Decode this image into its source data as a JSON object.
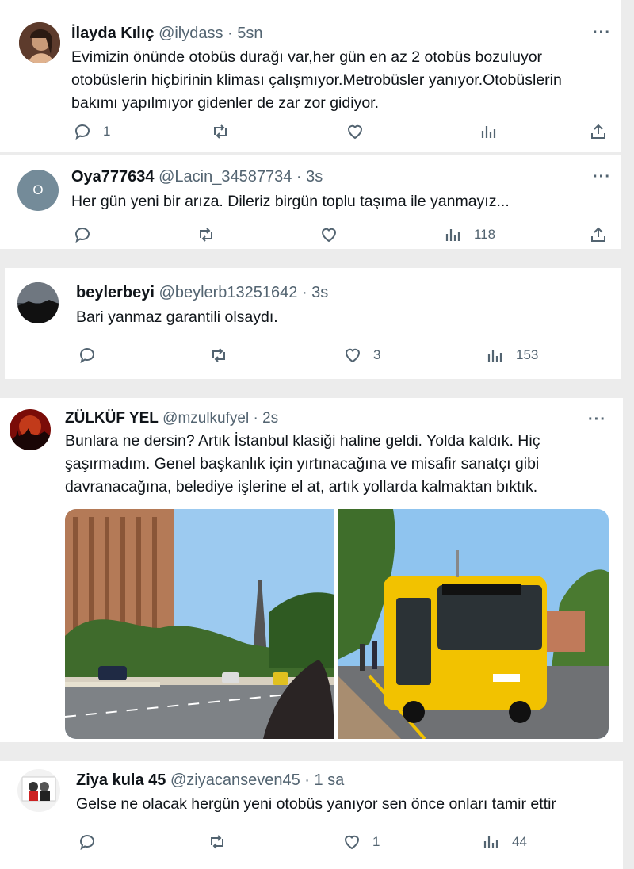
{
  "tweets": [
    {
      "name": "İlayda Kılıç",
      "handle": "@ilydass · 5sn",
      "text": "Evimizin önünde otobüs durağı var,her gün en az 2 otobüs bozuluyor otobüslerin hiçbirinin kliması çalışmıyor.Metrobüsler yanıyor.Otobüslerin bakımı yapılmıyor gidenler de zar zor gidiyor.",
      "replies": "1",
      "retweets": "",
      "likes": "",
      "views": ""
    },
    {
      "name": "Oya777634",
      "handle": "@Lacin_34587734 · 3s",
      "avatar_letter": "O",
      "text": "Her gün yeni bir arıza. Dileriz birgün toplu taşıma ile yanmayız...",
      "replies": "",
      "retweets": "",
      "likes": "",
      "views": "118"
    },
    {
      "name": "beylerbeyi",
      "handle": "@beylerb13251642 · 3s",
      "text": "Bari yanmaz garantili olsaydı.",
      "replies": "",
      "retweets": "",
      "likes": "3",
      "views": "153"
    },
    {
      "name": "ZÜLKÜF YEL",
      "handle": "@mzulkufyel · 2s",
      "text": "Bunlara ne dersin? Artık İstanbul klasiği haline geldi. Yolda kaldık. Hiç şaşırmadım. Genel başkanlık için yırtınacağına ve misafir sanatçı gibi davranacağına, belediye işlerine el at, artık yollarda kalmaktan bıktık.",
      "replies": "",
      "retweets": "",
      "likes": "",
      "views": ""
    },
    {
      "name": "Ziya kula 45",
      "handle": "@ziyacanseven45 · 1 sa",
      "text": "Gelse ne olacak hergün yeni otobüs yanıyor sen önce onları tamir ettir",
      "replies": "",
      "retweets": "",
      "likes": "1",
      "views": "44"
    }
  ],
  "more_label": "···",
  "colors": {
    "text": "#0f1419",
    "secondary": "#536471",
    "bus_yellow": "#f2c200",
    "sky": "#8fc4ef"
  },
  "icons": [
    "reply-icon",
    "retweet-icon",
    "like-icon",
    "views-icon",
    "share-icon",
    "more-icon"
  ]
}
